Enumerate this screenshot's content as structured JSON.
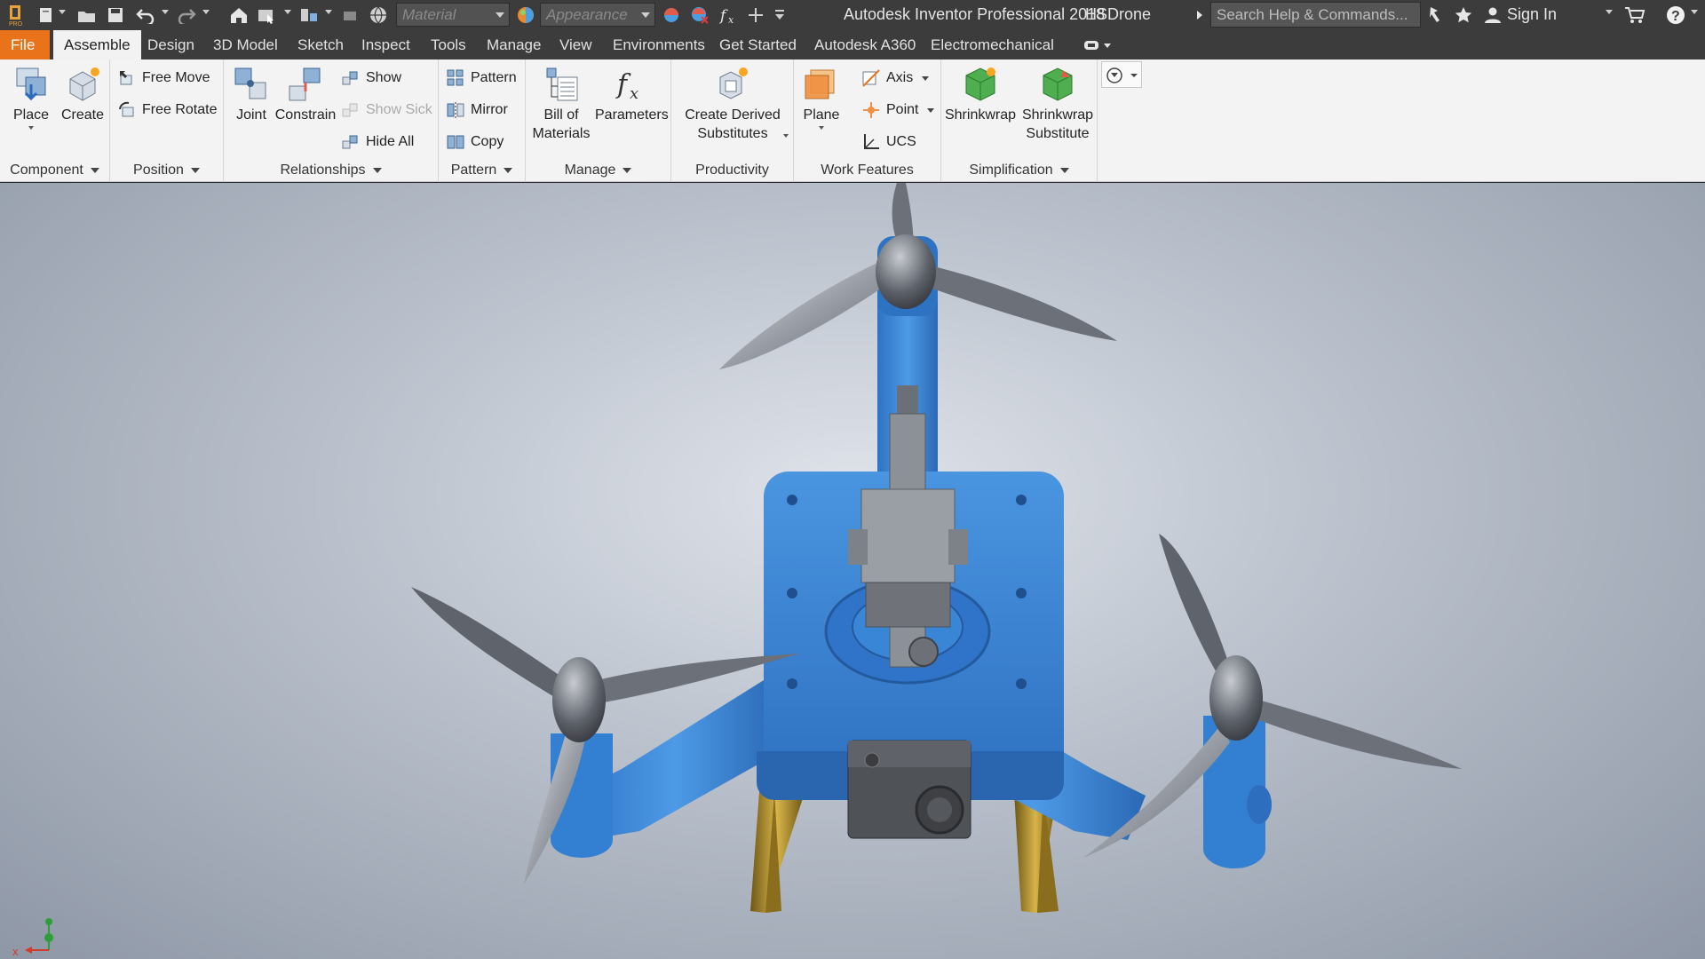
{
  "title_bar": {
    "app_title": "Autodesk Inventor Professional 2018",
    "document": "HSDrone",
    "material_placeholder": "Material",
    "appearance_placeholder": "Appearance",
    "search_placeholder": "Search Help & Commands...",
    "sign_in": "Sign In"
  },
  "tabs": [
    "File",
    "Assemble",
    "Design",
    "3D Model",
    "Sketch",
    "Inspect",
    "Tools",
    "Manage",
    "View",
    "Environments",
    "Get Started",
    "Autodesk A360",
    "Electromechanical"
  ],
  "active_tab": "Assemble",
  "ribbon": {
    "component": {
      "title": "Component",
      "place": "Place",
      "create": "Create"
    },
    "position": {
      "title": "Position",
      "free_move": "Free Move",
      "free_rotate": "Free Rotate"
    },
    "relationships": {
      "title": "Relationships",
      "joint": "Joint",
      "constrain": "Constrain",
      "show": "Show",
      "show_sick": "Show Sick",
      "hide_all": "Hide All"
    },
    "pattern": {
      "title": "Pattern",
      "pattern": "Pattern",
      "mirror": "Mirror",
      "copy": "Copy"
    },
    "manage": {
      "title": "Manage",
      "bom_line1": "Bill of",
      "bom_line2": "Materials",
      "parameters": "Parameters"
    },
    "productivity": {
      "title": "Productivity",
      "line1": "Create Derived",
      "line2": "Substitutes"
    },
    "work_features": {
      "title": "Work Features",
      "plane": "Plane",
      "axis": "Axis",
      "point": "Point",
      "ucs": "UCS"
    },
    "simplification": {
      "title": "Simplification",
      "shrinkwrap": "Shrinkwrap",
      "sub_line1": "Shrinkwrap",
      "sub_line2": "Substitute"
    }
  },
  "viewport": {
    "triad_x": "x",
    "colors": {
      "body": "#3a86d6",
      "prop": "#9a9ea6",
      "legs": "#b8962e",
      "camera": "#555"
    }
  }
}
